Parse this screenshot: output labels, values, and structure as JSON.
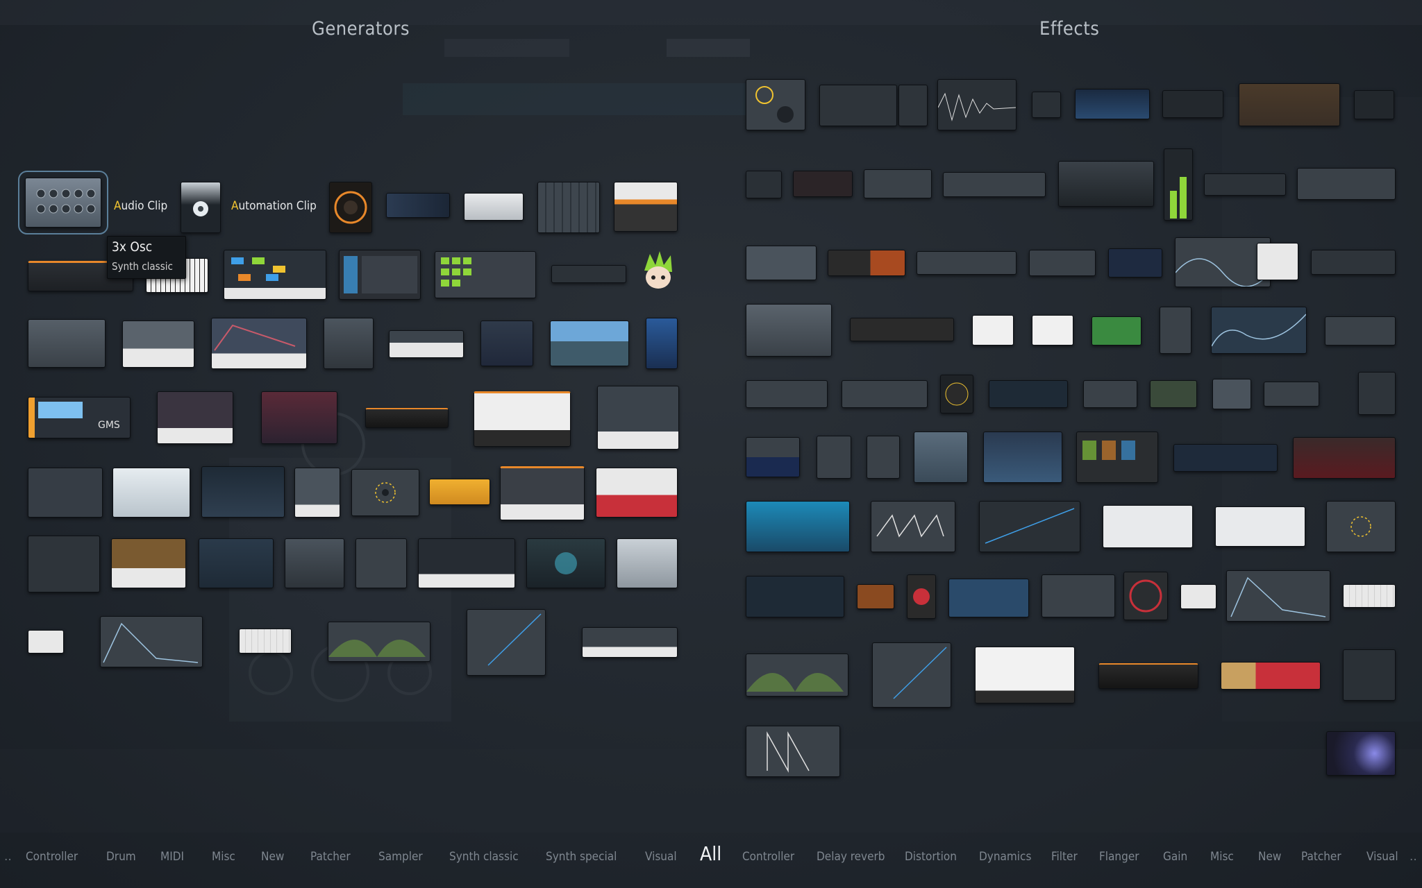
{
  "sections": {
    "generators": "Generators",
    "effects": "Effects"
  },
  "labels": {
    "audio_clip_first": "A",
    "audio_clip_rest": "udio Clip",
    "automation_clip_first": "A",
    "automation_clip_rest": "utomation Clip"
  },
  "tooltip": {
    "name": "3x Osc",
    "category": "Synth classic"
  },
  "bottom_tabs": {
    "generator_tabs": [
      "Controller",
      "Drum",
      "MIDI",
      "Misc",
      "New",
      "Patcher",
      "Sampler",
      "Synth classic",
      "Synth special",
      "Visual"
    ],
    "active": "All",
    "effect_tabs": [
      "Controller",
      "Delay reverb",
      "Distortion",
      "Dynamics",
      "Filter",
      "Flanger",
      "Gain",
      "Misc",
      "New",
      "Patcher",
      "Visual"
    ]
  },
  "colors": {
    "accent_yellow": "#f0c330",
    "accent_green": "#8fd63a",
    "accent_blue": "#3f9fe8",
    "accent_orange": "#e8882a",
    "accent_red": "#c8303a"
  }
}
